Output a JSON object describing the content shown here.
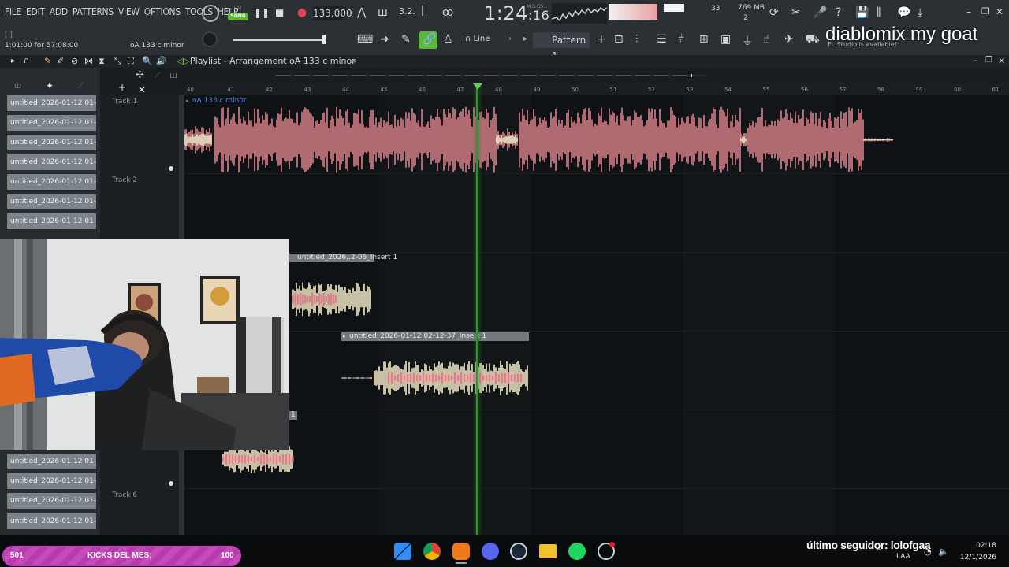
{
  "menu": [
    "FILE",
    "EDIT",
    "ADD",
    "PATTERNS",
    "VIEW",
    "OPTIONS",
    "TOOLS",
    "HELP"
  ],
  "pat_song": {
    "pat": "PAT",
    "song": "SONG"
  },
  "tempo": "133.000",
  "time": {
    "main": "1:24",
    "sub": ":16",
    "label": "M:S:CS"
  },
  "monitor": {
    "memory": "769 MB",
    "cpu_voices": "33",
    "polyphony": "2"
  },
  "hint_top_left": "[ ]",
  "hint_time": "1:01:00 for 57:08:00",
  "hint_pattern": "oA 133 c minor",
  "snap": "Line",
  "pattern_selector": "Pattern 1",
  "fl_notice": "FL Studio is available!",
  "overlay_text": "diablomix my goat",
  "playlist_title": "Playlist - Arrangement",
  "playlist_pattern": "oA 133 c minor",
  "picker_items": [
    "untitled_2026-01-12 01-...",
    "untitled_2026-01-12 01-...",
    "untitled_2026-01-12 01-...",
    "untitled_2026-01-12 01-...",
    "untitled_2026-01-12 01-...",
    "untitled_2026-01-12 01-...",
    "untitled_2026-01-12 01-...",
    "untitled_2026-01-12 01-...",
    "untitled_2026-01-12 01-...",
    "untitled_2026-01-12 01-...",
    "untitled_2026-01-12 01-..."
  ],
  "tracks": {
    "t1": "Track 1",
    "t2": "Track 2",
    "t6": "Track 6"
  },
  "bars": [
    "40",
    "41",
    "42",
    "43",
    "44",
    "45",
    "46",
    "47",
    "48",
    "49",
    "50",
    "51",
    "52",
    "53",
    "54",
    "55",
    "56",
    "57",
    "58",
    "59",
    "60",
    "61"
  ],
  "clips": {
    "c1": "oA 133 c minor",
    "c2": "untitled_2026..2-06_Insert 1",
    "c3": "untitled_2026-01-12 02-12-37_Insert 1",
    "c4": "1"
  },
  "taskbar": {
    "kicks_count": "501",
    "kicks_label": "KICKS DEL MES:",
    "kicks_goal": "100",
    "follower": "último seguidor: lolofgaa",
    "lang": "LAA",
    "time": "02:18",
    "date": "12/1/2026"
  },
  "colors": {
    "accent_green": "#57b83a",
    "clip_pink": "#d9818a",
    "audio_cream": "#f4ecc8",
    "kicks_magenta": "#b93aad"
  }
}
